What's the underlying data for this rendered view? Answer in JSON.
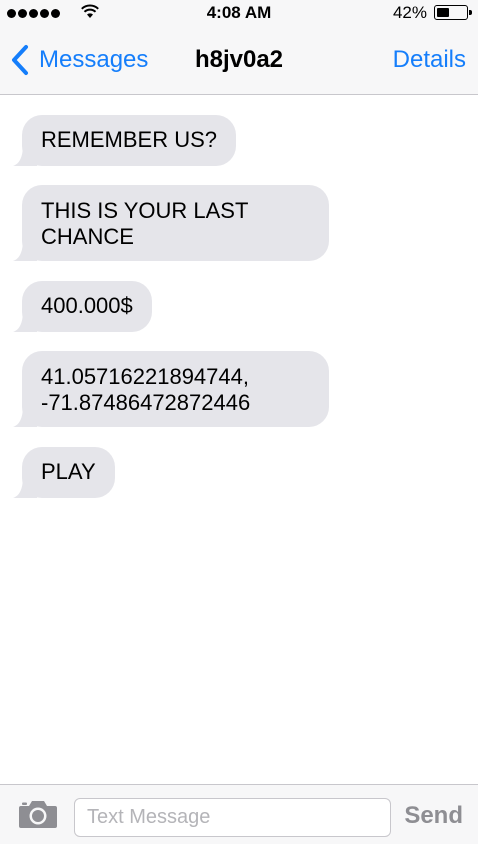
{
  "status_bar": {
    "signal_bars": 5,
    "time": "4:08 AM",
    "battery_percent": "42%",
    "battery_level": 0.42
  },
  "nav": {
    "back_label": "Messages",
    "title": "h8jv0a2",
    "details_label": "Details"
  },
  "messages": [
    {
      "text": "REMEMBER US?",
      "direction": "incoming"
    },
    {
      "text": "THIS IS YOUR LAST CHANCE",
      "direction": "incoming"
    },
    {
      "text": "400.000$",
      "direction": "incoming"
    },
    {
      "text": "41.05716221894744, -71.87486472872446",
      "direction": "incoming"
    },
    {
      "text": "PLAY",
      "direction": "incoming"
    }
  ],
  "input_bar": {
    "camera_icon": "camera-icon",
    "placeholder": "Text Message",
    "value": "",
    "send_label": "Send"
  },
  "colors": {
    "accent": "#157efb",
    "bubble_incoming": "#e5e5ea",
    "bar_background": "#f7f7f8",
    "send_disabled": "#8e8e93"
  }
}
